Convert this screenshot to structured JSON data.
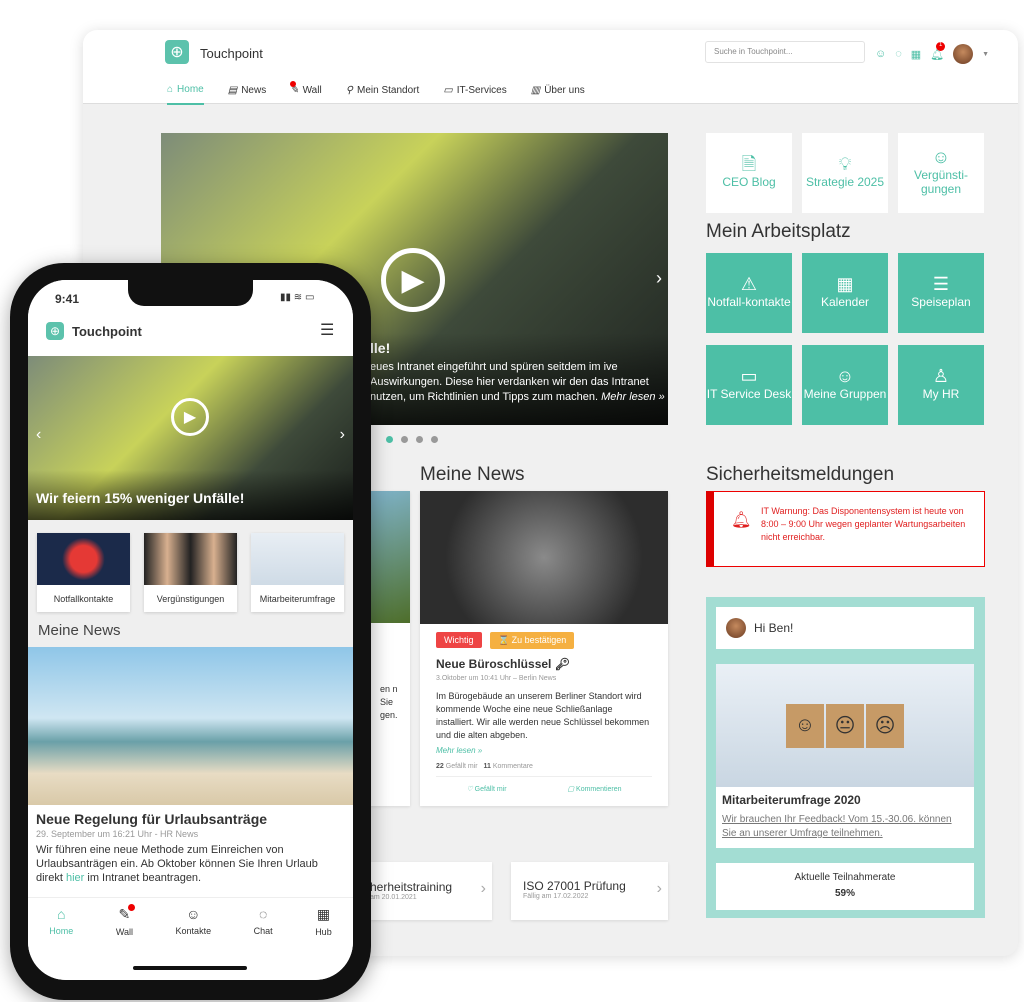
{
  "colors": {
    "accent": "#4dbfa6",
    "alert": "#e02020",
    "badge_important": "#ee4444",
    "badge_confirm": "#f5b041"
  },
  "desktop": {
    "app_title": "Touchpoint",
    "search_placeholder": "Suche in Touchpoint...",
    "notification_count": "1",
    "nav": [
      {
        "label": "Home",
        "icon": "home-icon"
      },
      {
        "label": "News",
        "icon": "newspaper-icon"
      },
      {
        "label": "Wall",
        "icon": "edit-icon"
      },
      {
        "label": "Mein Standort",
        "icon": "location-pin-icon"
      },
      {
        "label": "IT-Services",
        "icon": "monitor-icon"
      },
      {
        "label": "Über uns",
        "icon": "building-icon"
      }
    ],
    "hero": {
      "title": "lle!",
      "text": "eues Intranet eingeführt und spüren seitdem im ive Auswirkungen. Diese hier verdanken wir den das Intranet nutzen, um Richtlinien und Tipps zum machen.",
      "more": "Mehr lesen »",
      "active_slide": 1,
      "slide_count": 4
    },
    "quick_tiles": [
      {
        "label": "CEO Blog",
        "icon": "document-icon"
      },
      {
        "label": "Strategie 2025",
        "icon": "lightbulb-icon"
      },
      {
        "label": "Vergünsti-gungen",
        "icon": "smiley-icon"
      }
    ],
    "workplace_title": "Mein Arbeitsplatz",
    "workplace_tiles": [
      {
        "label": "Notfall-kontakte",
        "icon": "warning-icon"
      },
      {
        "label": "Kalender",
        "icon": "calendar-icon"
      },
      {
        "label": "Speiseplan",
        "icon": "burger-icon"
      },
      {
        "label": "IT Service Desk",
        "icon": "monitor-icon"
      },
      {
        "label": "Meine Gruppen",
        "icon": "group-icon"
      },
      {
        "label": "My HR",
        "icon": "person-icon"
      }
    ],
    "news_title": "Meine News",
    "news_partial_text": "en n Sie gen.",
    "news_card": {
      "badges": [
        "Wichtig",
        "⌛ Zu bestätigen"
      ],
      "title": "Neue Büroschlüssel",
      "meta": "3.Oktober um 10:41 Uhr – Berlin News",
      "text": "Im Bürogebäude an unserem Berliner Standort wird kommende Woche eine neue Schließanlage installiert. Wir alle werden neue Schlüssel bekommen und die alten abgeben.",
      "more": "Mehr lesen »",
      "likes": "22",
      "likes_label": "Gefällt mir",
      "comments": "11",
      "comments_label": "Kommentare",
      "like_action": "Gefällt mir",
      "comment_action": "Kommentieren"
    },
    "security_title": "Sicherheitsmeldungen",
    "security_alert": "IT Warnung: Das Disponentensystem ist heute von 8:00 – 9:00 Uhr wegen geplanter Wartungsarbeiten nicht erreichbar.",
    "greeting": "Hi Ben!",
    "survey": {
      "title": "Mitarbeiterumfrage 2020",
      "text": "Wir brauchen Ihr Feedback! Vom 15.-30.06. können Sie an unserer Umfrage teilnehmen.",
      "rate_label": "Aktuelle Teilnahmerate",
      "rate": "59%"
    },
    "tasks": [
      {
        "title": "herheitstraining",
        "due": "am 20.01.2021"
      },
      {
        "title": "ISO 27001 Prüfung",
        "due": "Fällig am 17.02.2022"
      }
    ]
  },
  "phone": {
    "time": "9:41",
    "app_title": "Touchpoint",
    "hero_title": "Wir feiern 15% weniger Unfälle!",
    "tiles": [
      "Notfallkontakte",
      "Vergünstigungen",
      "Mitarbeiterumfrage"
    ],
    "news_title": "Meine News",
    "news": {
      "title": "Neue Regelung für Urlaubsanträge",
      "meta": "29. September um 16:21 Uhr - HR News",
      "text_before": "Wir führen eine neue Methode zum Einreichen von Urlaubsanträgen ein. Ab Oktober können Sie Ihren Urlaub direkt ",
      "link": "hier",
      "text_after": " im Intranet beantragen."
    },
    "tabs": [
      {
        "label": "Home",
        "icon": "home-icon"
      },
      {
        "label": "Wall",
        "icon": "edit-icon"
      },
      {
        "label": "Kontakte",
        "icon": "contacts-icon"
      },
      {
        "label": "Chat",
        "icon": "chat-icon"
      },
      {
        "label": "Hub",
        "icon": "grid-icon"
      }
    ]
  }
}
